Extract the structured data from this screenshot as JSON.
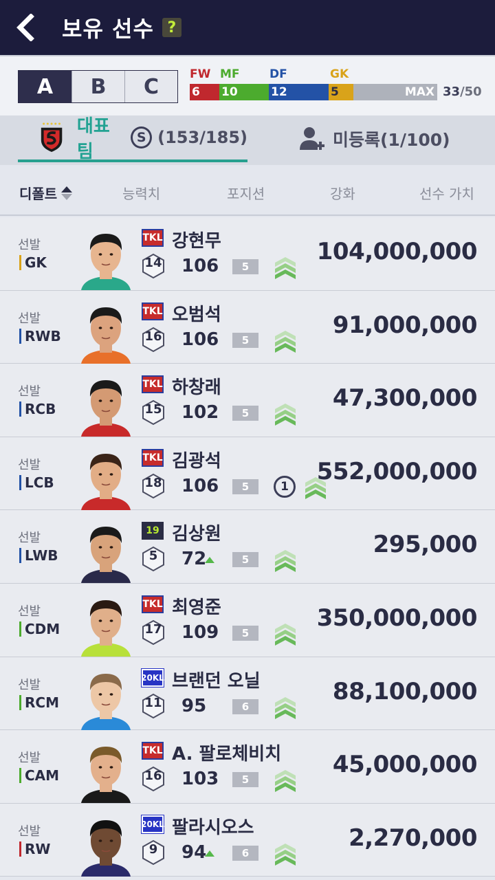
{
  "header": {
    "title": "보유 선수",
    "help_label": "?"
  },
  "squads": {
    "tabs": [
      "A",
      "B",
      "C"
    ],
    "active": "A"
  },
  "positions": {
    "fw": {
      "label": "FW",
      "count": "6",
      "color": "#c0282e"
    },
    "mf": {
      "label": "MF",
      "count": "10",
      "color": "#4cab2e"
    },
    "df": {
      "label": "DF",
      "count": "12",
      "color": "#2352a6"
    },
    "gk": {
      "label": "GK",
      "count": "5",
      "color": "#d9a31a"
    },
    "max_label": "MAX",
    "current": "33",
    "total": "/50"
  },
  "tabs": {
    "team_name": "대표팀",
    "team_badge": "S",
    "team_count": "(153/185)",
    "unregistered": "미등록(1/100)"
  },
  "sort": {
    "default": "디폴트",
    "ability": "능력치",
    "position": "포지션",
    "enhance": "강화",
    "value": "선수 가치"
  },
  "players": [
    {
      "status": "선발",
      "position": "GK",
      "pos_color": "#d9a31a",
      "season": "TKL",
      "season_type": "tkl",
      "name": "강현무",
      "number": "14",
      "ovr": "106",
      "up": false,
      "level": "5",
      "boost": "",
      "value": "104,000,000"
    },
    {
      "status": "선발",
      "position": "RWB",
      "pos_color": "#2352a6",
      "season": "TKL",
      "season_type": "tkl",
      "name": "오범석",
      "number": "16",
      "ovr": "106",
      "up": false,
      "level": "5",
      "boost": "",
      "value": "91,000,000"
    },
    {
      "status": "선발",
      "position": "RCB",
      "pos_color": "#2352a6",
      "season": "TKL",
      "season_type": "tkl",
      "name": "하창래",
      "number": "15",
      "ovr": "102",
      "up": false,
      "level": "5",
      "boost": "",
      "value": "47,300,000"
    },
    {
      "status": "선발",
      "position": "LCB",
      "pos_color": "#2352a6",
      "season": "TKL",
      "season_type": "tkl",
      "name": "김광석",
      "number": "18",
      "ovr": "106",
      "up": false,
      "level": "5",
      "boost": "1",
      "value": "552,000,000"
    },
    {
      "status": "선발",
      "position": "LWB",
      "pos_color": "#2352a6",
      "season": "19",
      "season_type": "s19",
      "name": "김상원",
      "number": "5",
      "ovr": "72",
      "up": true,
      "level": "5",
      "boost": "",
      "value": "295,000"
    },
    {
      "status": "선발",
      "position": "CDM",
      "pos_color": "#4cab2e",
      "season": "TKL",
      "season_type": "tkl",
      "name": "최영준",
      "number": "17",
      "ovr": "109",
      "up": false,
      "level": "5",
      "boost": "",
      "value": "350,000,000"
    },
    {
      "status": "선발",
      "position": "RCM",
      "pos_color": "#4cab2e",
      "season": "20KL",
      "season_type": "s20",
      "name": "브랜던 오닐",
      "number": "11",
      "ovr": "95",
      "up": false,
      "level": "6",
      "boost": "",
      "value": "88,100,000"
    },
    {
      "status": "선발",
      "position": "CAM",
      "pos_color": "#4cab2e",
      "season": "TKL",
      "season_type": "tkl",
      "name": "A. 팔로체비치",
      "number": "16",
      "ovr": "103",
      "up": false,
      "level": "5",
      "boost": "",
      "value": "45,000,000"
    },
    {
      "status": "선발",
      "position": "RW",
      "pos_color": "#c0282e",
      "season": "20KL",
      "season_type": "s20",
      "name": "팔라시오스",
      "number": "9",
      "ovr": "94",
      "up": true,
      "level": "6",
      "boost": "",
      "value": "2,270,000"
    }
  ]
}
